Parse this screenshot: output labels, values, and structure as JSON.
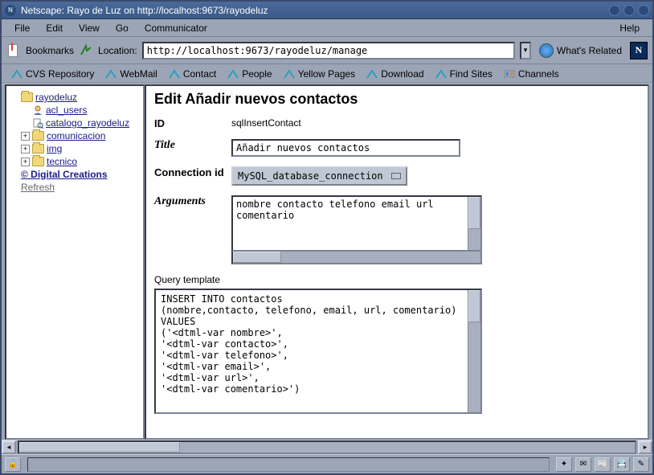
{
  "window": {
    "title": "Netscape: Rayo de Luz on http://localhost:9673/rayodeluz"
  },
  "menu": {
    "file": "File",
    "edit": "Edit",
    "view": "View",
    "go": "Go",
    "communicator": "Communicator",
    "help": "Help"
  },
  "toolbar": {
    "bookmarks": "Bookmarks",
    "location_label": "Location:",
    "url": "http://localhost:9673/rayodeluz/manage",
    "whats_related": "What's Related",
    "n_logo": "N"
  },
  "personal_bar": {
    "cvs": "CVS Repository",
    "webmail": "WebMail",
    "contact": "Contact",
    "people": "People",
    "yellow": "Yellow Pages",
    "download": "Download",
    "find": "Find Sites",
    "channels": "Channels"
  },
  "sidebar": {
    "root": "rayodeluz",
    "acl": "acl_users",
    "catalogo": "catalogo_rayodeluz",
    "comunicacion": "comunicacion",
    "img": "img",
    "tecnico": "tecnico",
    "digital": "© Digital Creations",
    "refresh": "Refresh"
  },
  "form": {
    "heading": "Edit Añadir nuevos contactos",
    "id_label": "ID",
    "id_value": "sqlInsertContact",
    "title_label": "Title",
    "title_value": "Añadir nuevos contactos",
    "conn_label": "Connection id",
    "conn_value": "MySQL_database_connection",
    "args_label": "Arguments",
    "args_value": "nombre contacto telefono email url comentario",
    "query_label": "Query template",
    "query_value": "INSERT INTO contactos\n(nombre,contacto, telefono, email, url, comentario)\nVALUES\n('<dtml-var nombre>',\n'<dtml-var contacto>',\n'<dtml-var telefono>',\n'<dtml-var email>',\n'<dtml-var url>',\n'<dtml-var comentario>')"
  }
}
